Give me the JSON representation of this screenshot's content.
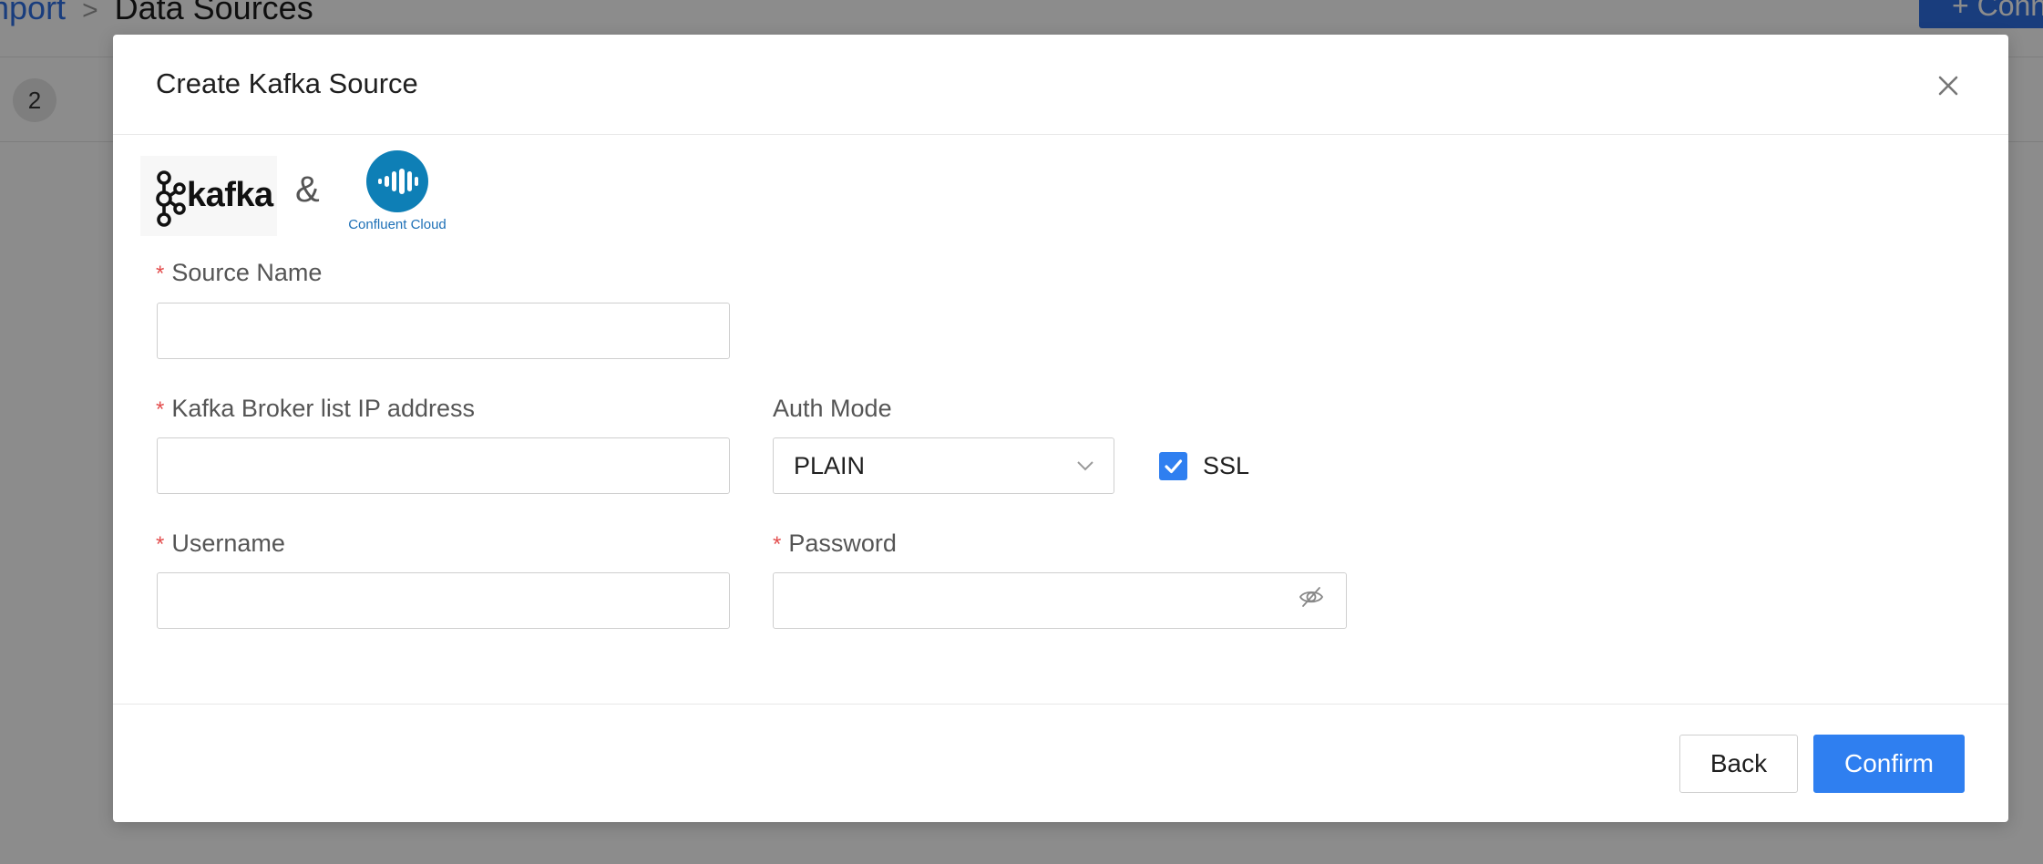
{
  "background": {
    "breadcrumb": {
      "parent": "nport",
      "separator": ">",
      "current": "Data Sources"
    },
    "top_button_label": "+ Conn",
    "step_badge": "2"
  },
  "modal": {
    "title": "Create Kafka Source",
    "logos": {
      "kafka_text": "kafka",
      "ampersand": "&",
      "confluent_text": "Confluent Cloud"
    },
    "fields": {
      "source_name": {
        "label": "Source Name",
        "required": "*",
        "value": "",
        "placeholder": ""
      },
      "broker_list": {
        "label": "Kafka Broker list IP address",
        "required": "*",
        "value": "",
        "placeholder": ""
      },
      "auth_mode": {
        "label": "Auth Mode",
        "selected": "PLAIN"
      },
      "ssl": {
        "label": "SSL",
        "checked": true
      },
      "username": {
        "label": "Username",
        "required": "*",
        "value": "",
        "placeholder": ""
      },
      "password": {
        "label": "Password",
        "required": "*",
        "value": "",
        "placeholder": ""
      }
    },
    "footer": {
      "back_label": "Back",
      "confirm_label": "Confirm"
    }
  },
  "colors": {
    "primary": "#2f7ff0",
    "required": "#e34d4d",
    "confluent_blue": "#1c6fb6"
  },
  "icons": [
    "close-icon",
    "chevron-down-icon",
    "checkmark-icon",
    "eye-off-icon",
    "kafka-logo-icon",
    "confluent-logo-icon"
  ]
}
